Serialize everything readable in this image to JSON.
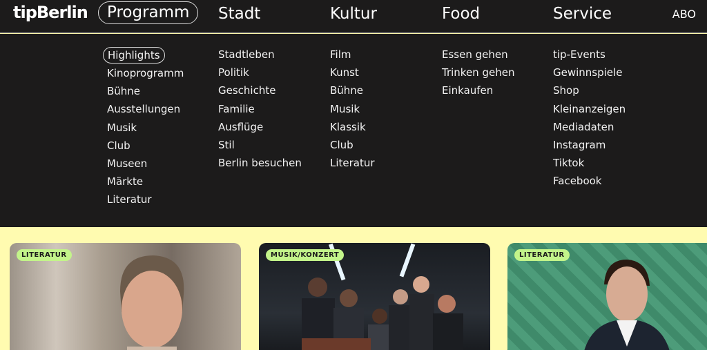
{
  "logo": "tipBerlin",
  "nav": {
    "items": [
      "Programm",
      "Stadt",
      "Kultur",
      "Food",
      "Service"
    ],
    "abo": "ABO"
  },
  "menu": {
    "columns": [
      [
        "Highlights",
        "Kinoprogramm",
        "Bühne",
        "Ausstellungen",
        "Musik",
        "Club",
        "Museen",
        "Märkte",
        "Literatur"
      ],
      [
        "Stadtleben",
        "Politik",
        "Geschichte",
        "Familie",
        "Ausflüge",
        "Stil",
        "Berlin besuchen"
      ],
      [
        "Film",
        "Kunst",
        "Bühne",
        "Musik",
        "Klassik",
        "Club",
        "Literatur"
      ],
      [
        "Essen gehen",
        "Trinken gehen",
        "Einkaufen"
      ],
      [
        "tip-Events",
        "Gewinnspiele",
        "Shop",
        "Kleinanzeigen",
        "Mediadaten",
        "Instagram",
        "Tiktok",
        "Facebook"
      ]
    ]
  },
  "cards": [
    {
      "category": "LITERATUR"
    },
    {
      "category": "MUSIK/KONZERT"
    },
    {
      "category": "LITERATUR"
    }
  ],
  "colors": {
    "background_dark": "#1c1b1b",
    "background_yellow": "#fffbb0",
    "badge_green": "#c3f48a"
  }
}
